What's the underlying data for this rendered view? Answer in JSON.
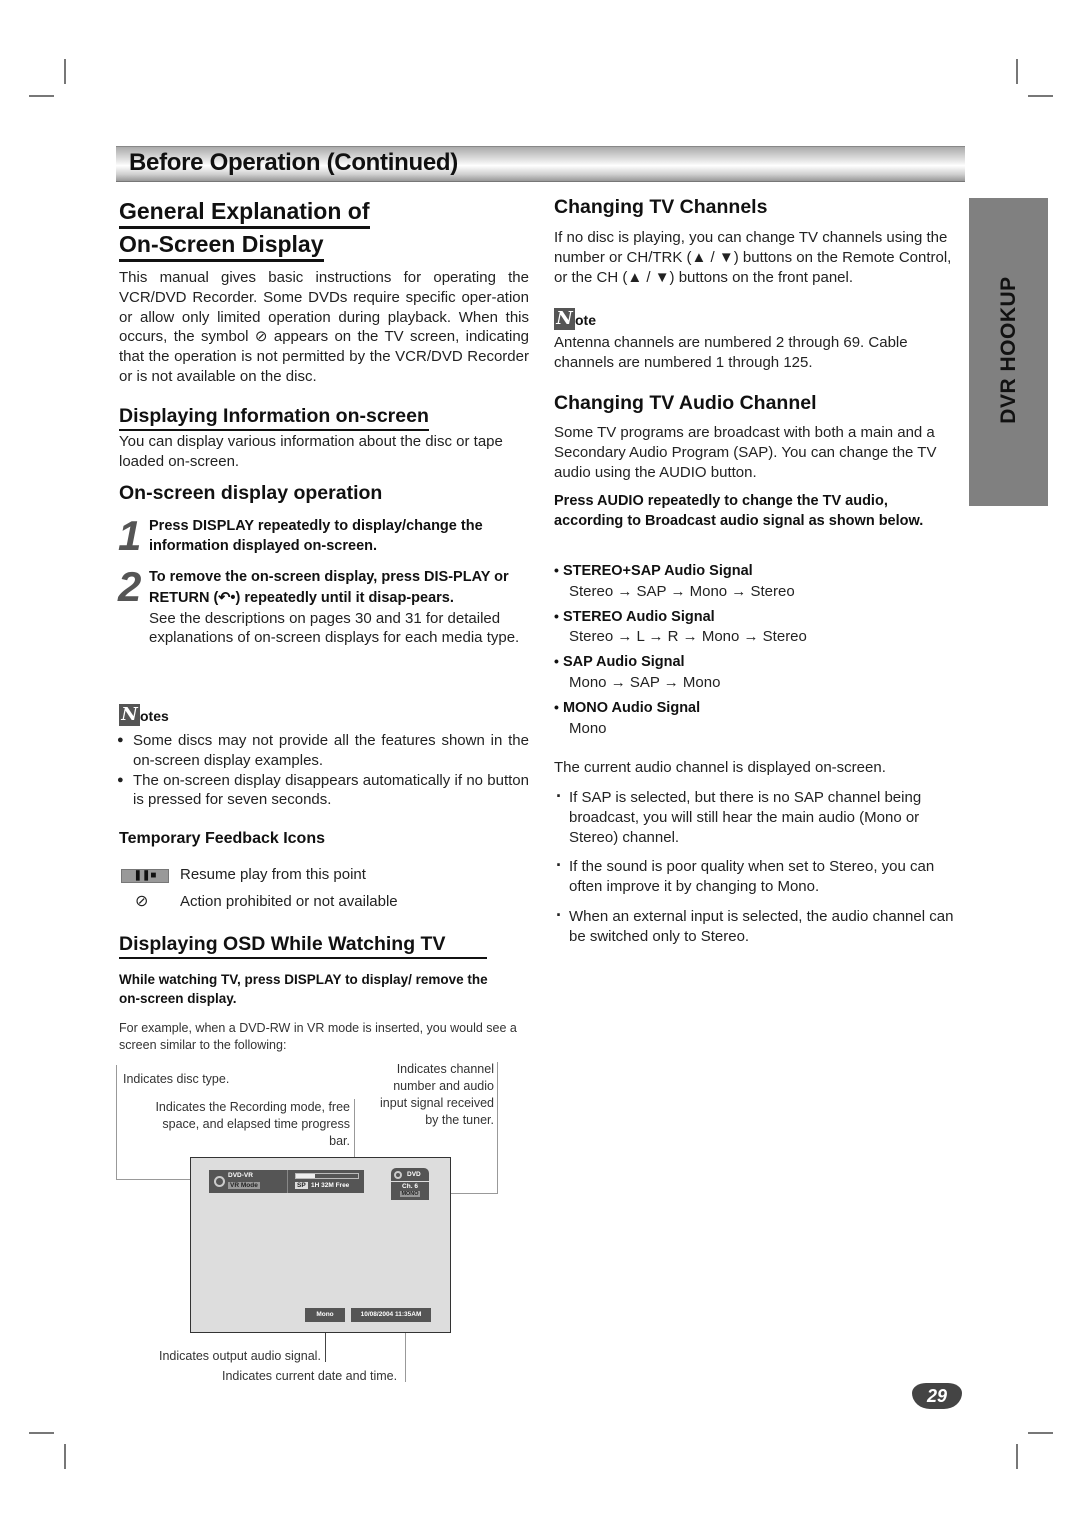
{
  "banner": {
    "title": "Before Operation (Continued)"
  },
  "side_tab": {
    "label": "DVR HOOKUP"
  },
  "left": {
    "title_line1": "General Explanation of",
    "title_line2": "On-Screen Display",
    "intro_pre": "This manual gives basic instructions for operating the VCR/DVD Recorder. Some DVDs require specific oper-ation or allow only limited operation during playback. When this occurs, the symbol",
    "intro_post": "appears on the TV screen, indicating that the operation is not permitted by the VCR/DVD Recorder or is not available on the disc.",
    "displaying_info": {
      "heading": "Displaying Information on-screen",
      "text": "You can display various information about the disc or tape loaded on-screen."
    },
    "osd_operation": {
      "heading": "On-screen display operation",
      "steps": [
        {
          "num": "1",
          "text": "Press DISPLAY repeatedly to display/change the information displayed on-screen."
        },
        {
          "num": "2",
          "text_pre": "To remove the on-screen display, press DIS-PLAY or RETURN (",
          "text_post": ") repeatedly until it disap-pears.",
          "detail": "See the descriptions on pages 30 and 31 for detailed explanations of on-screen displays for each media type."
        }
      ]
    },
    "notes": {
      "icon_letter": "N",
      "label": "otes",
      "items": [
        "Some discs may not provide all the features shown in the on-screen display examples.",
        "The on-screen display disappears automatically if no button is pressed for seven seconds."
      ]
    },
    "feedback_icons": {
      "heading": "Temporary Feedback Icons",
      "items": [
        {
          "icon": "resume-icon",
          "text": "Resume play from this point"
        },
        {
          "icon": "prohibited-icon",
          "text": "Action prohibited or not available"
        }
      ]
    },
    "osd_tv": {
      "heading": "Displaying OSD While Watching TV",
      "instruction": "While watching TV, press DISPLAY to display/ remove the on-screen display.",
      "example": "For example, when a DVD-RW in VR mode is inserted, you would see a screen similar to the following:",
      "callouts": {
        "disc_type": "Indicates disc type.",
        "recording_mode": "Indicates the Recording mode, free space, and elapsed time progress bar.",
        "channel": "Indicates channel number and audio input signal received by the tuner.",
        "output_audio": "Indicates output audio signal.",
        "date_time": "Indicates current date and time."
      },
      "screen": {
        "disc": "DVD-VR",
        "mode": "VR Mode",
        "rec_speed": "SP",
        "free": "1H 32M Free",
        "progress": 0.3,
        "source": "DVD",
        "channel": "Ch. 6",
        "audio_in": "MONO",
        "audio_out": "Mono",
        "datetime": "10/08/2004 11:35AM"
      }
    }
  },
  "right": {
    "channels": {
      "heading": "Changing TV Channels",
      "text": "If no disc is playing, you can change TV channels using the number or CH/TRK (▲ / ▼) buttons on the Remote Control, or the CH (▲ / ▼) buttons on the front panel.",
      "note_label": "ote",
      "note_text": "Antenna channels are numbered 2 through 69. Cable channels are numbered 1 through 125."
    },
    "audio": {
      "heading": "Changing TV Audio Channel",
      "text": "Some TV programs are broadcast with both a main and a Secondary Audio Program (SAP). You can change the TV audio using the AUDIO button.",
      "instruction": "Press AUDIO repeatedly to change the TV audio, according to Broadcast audio signal as shown below.",
      "signals": [
        {
          "name": "STEREO+SAP Audio Signal",
          "seq": "Stereo → SAP → Mono → Stereo"
        },
        {
          "name": "STEREO Audio Signal",
          "seq": "Stereo → L → R → Mono → Stereo"
        },
        {
          "name": "SAP Audio Signal",
          "seq": "Mono → SAP → Mono"
        },
        {
          "name": "MONO Audio Signal",
          "seq": "Mono"
        }
      ],
      "current": "The current audio channel is displayed on-screen.",
      "tips": [
        "If SAP is selected, but there is no SAP channel being broadcast, you will still hear the main audio (Mono or Stereo) channel.",
        "If the sound is poor quality when set to Stereo, you can often improve it by changing to Mono.",
        "When an external input is selected, the audio channel can be switched only to Stereo."
      ]
    }
  },
  "page_number": "29"
}
